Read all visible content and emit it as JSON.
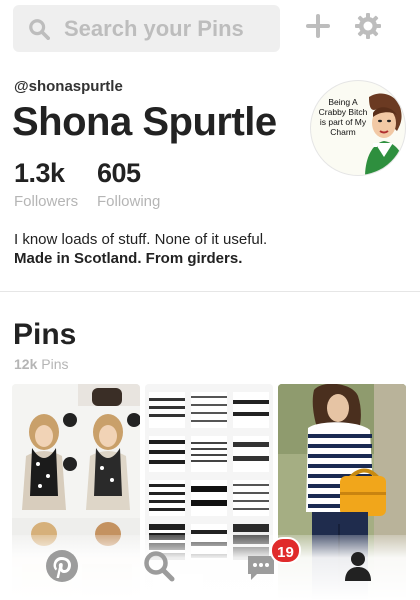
{
  "search": {
    "placeholder": "Search your Pins"
  },
  "profile": {
    "handle": "@shonaspurtle",
    "name": "Shona Spurtle",
    "followers_count": "1.3k",
    "followers_label": "Followers",
    "following_count": "605",
    "following_label": "Following",
    "bio_line1": "I know loads of stuff. None of it useful.",
    "bio_line2": "Made in Scotland. From girders.",
    "avatar_text": "Being A Crabby Bitch is part of My Charm"
  },
  "pins": {
    "title": "Pins",
    "count": "12k",
    "count_label": "Pins"
  },
  "nav": {
    "items": [
      "pinterest-home",
      "search",
      "messages",
      "profile"
    ],
    "messages_badge": "19"
  },
  "colors": {
    "accent_red": "#e02b2b",
    "icon_gray": "#bdbdbd",
    "muted_text": "#b5b5b5"
  }
}
